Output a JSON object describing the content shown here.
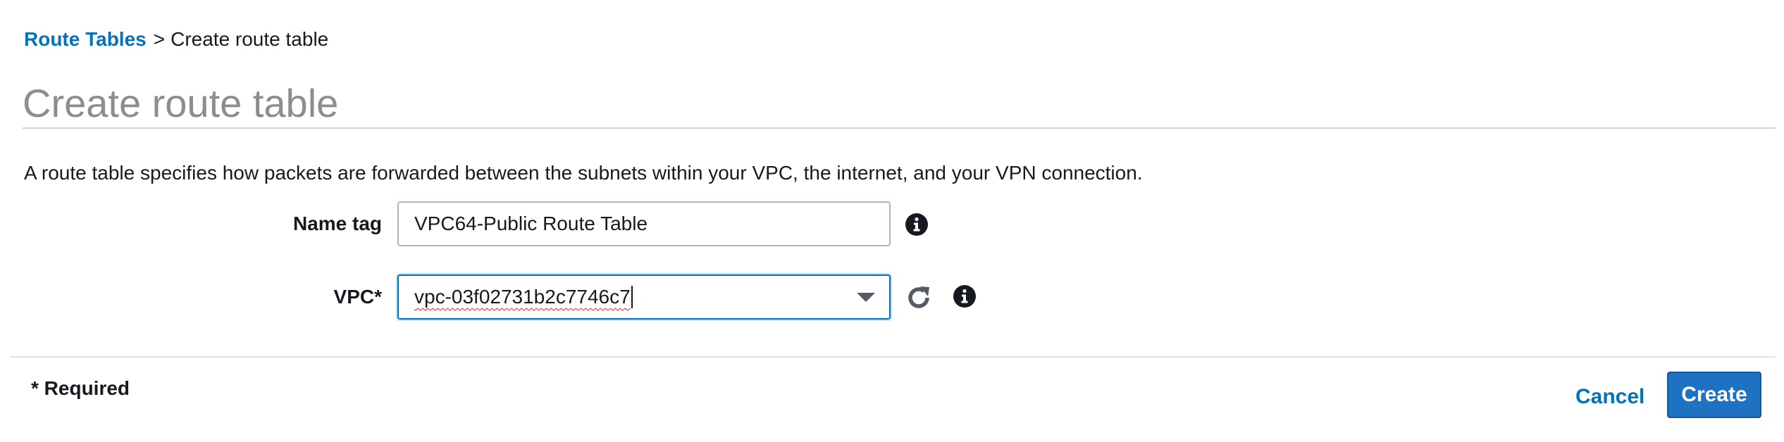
{
  "breadcrumb": {
    "root_label": "Route Tables",
    "separator": ">",
    "current_label": "Create route table"
  },
  "page": {
    "title": "Create route table",
    "description": "A route table specifies how packets are forwarded between the subnets within your VPC, the internet, and your VPN connection."
  },
  "form": {
    "name_tag": {
      "label": "Name tag",
      "value": "VPC64-Public Route Table",
      "info_icon": "info-circle-icon"
    },
    "vpc": {
      "label": "VPC*",
      "value": "vpc-03f02731b2c7746c7",
      "refresh_icon": "refresh-icon",
      "info_icon": "info-circle-icon"
    }
  },
  "footer": {
    "required_note": "* Required",
    "cancel_label": "Cancel",
    "create_label": "Create"
  },
  "colors": {
    "link": "#0073bb",
    "primary_button": "#1f72c2",
    "title": "#8d8d8d",
    "focus_border": "#0073bb"
  }
}
